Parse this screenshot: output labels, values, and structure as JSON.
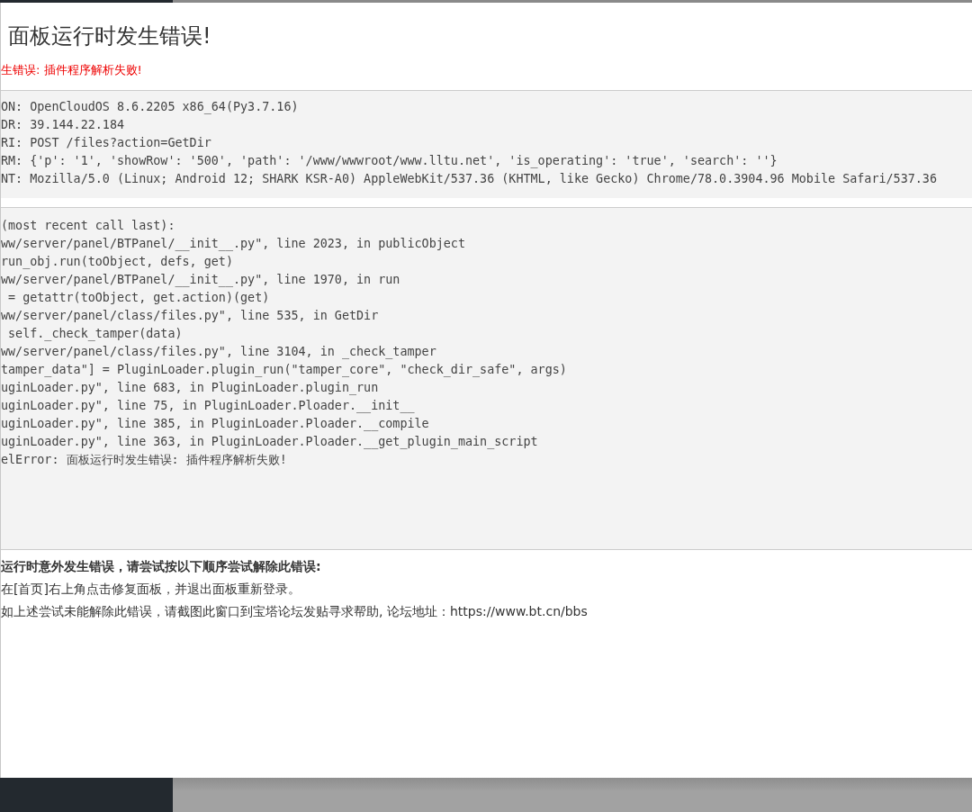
{
  "dialog": {
    "title": "面板运行时发生错误!",
    "error_message": "生错误: 插件程序解析失败!"
  },
  "request_info": [
    "ON: OpenCloudOS 8.6.2205 x86_64(Py3.7.16)",
    "DR: 39.144.22.184",
    "RI: POST /files?action=GetDir",
    "RM: {'p': '1', 'showRow': '500', 'path': '/www/wwwroot/www.lltu.net', 'is_operating': 'true', 'search': ''}",
    "NT: Mozilla/5.0 (Linux; Android 12; SHARK KSR-A0) AppleWebKit/537.36 (KHTML, like Gecko) Chrome/78.0.3904.96 Mobile Safari/537.36"
  ],
  "traceback": [
    "(most recent call last):",
    "ww/server/panel/BTPanel/__init__.py\", line 2023, in publicObject",
    "run_obj.run(toObject, defs, get)",
    "ww/server/panel/BTPanel/__init__.py\", line 1970, in run",
    " = getattr(toObject, get.action)(get)",
    "ww/server/panel/class/files.py\", line 535, in GetDir",
    " self._check_tamper(data)",
    "ww/server/panel/class/files.py\", line 3104, in _check_tamper",
    "tamper_data\"] = PluginLoader.plugin_run(\"tamper_core\", \"check_dir_safe\", args)",
    "uginLoader.py\", line 683, in PluginLoader.plugin_run",
    "uginLoader.py\", line 75, in PluginLoader.Ploader.__init__",
    "uginLoader.py\", line 385, in PluginLoader.Ploader.__compile",
    "uginLoader.py\", line 363, in PluginLoader.Ploader.__get_plugin_main_script",
    "elError: 面板运行时发生错误: 插件程序解析失败!"
  ],
  "help": {
    "heading": "运行时意外发生错误，请尝试按以下顺序尝试解除此错误:",
    "steps": [
      "在[首页]右上角点击修复面板，并退出面板重新登录。",
      "如上述尝试未能解除此错误，请截图此窗口到宝塔论坛发贴寻求帮助, 论坛地址："
    ],
    "link": "https://www.bt.cn/bbs"
  }
}
